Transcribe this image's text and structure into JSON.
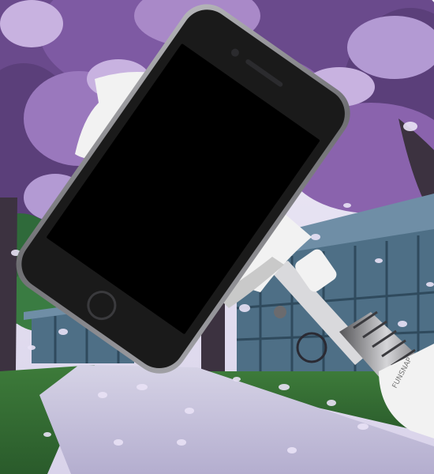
{
  "scene": {
    "subject": "phone-on-selfie-stick-frame",
    "background": "cherry-blossom-park-path",
    "colors": {
      "sky": "#e8e6f2",
      "blossom_dark": "#5b3f7a",
      "blossom_mid": "#8a63ad",
      "blossom_light": "#c8b2e0",
      "foliage": "#2f6a3a",
      "grass": "#3f7d3a",
      "path": "#c7c4dc",
      "path_shadow": "#a8a2c6",
      "building": "#4e6f86",
      "building_dark": "#2f4a5d",
      "roof": "#6f8ea6",
      "tree_trunk": "#3c3240",
      "phone_body": "#1a1a1a",
      "phone_edge": "#8e8e92",
      "phone_screen": "#000000",
      "stick_white": "#f2f2f2",
      "stick_shadow": "#c9c9c9",
      "stick_metal": "#6b6b6e"
    },
    "stick_brand_text": "FUNSNAP"
  }
}
